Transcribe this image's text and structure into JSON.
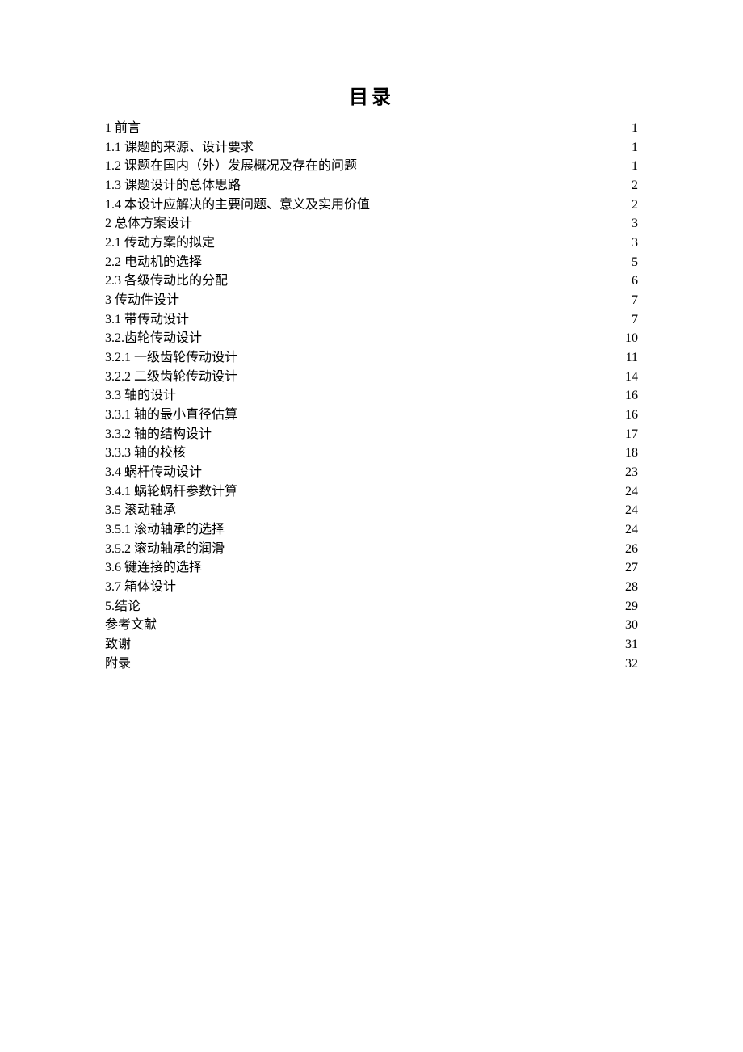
{
  "title": "目录",
  "toc": [
    {
      "label": "1 前言",
      "page": "1"
    },
    {
      "label": "1.1 课题的来源、设计要求",
      "page": "1"
    },
    {
      "label": "1.2 课题在国内（外）发展概况及存在的问题",
      "page": "1"
    },
    {
      "label": "1.3 课题设计的总体思路",
      "page": "2"
    },
    {
      "label": "1.4 本设计应解决的主要问题、意义及实用价值",
      "page": "2"
    },
    {
      "label": "2 总体方案设计",
      "page": "3"
    },
    {
      "label": "2.1 传动方案的拟定",
      "page": "3"
    },
    {
      "label": "2.2 电动机的选择",
      "page": "5"
    },
    {
      "label": "2.3 各级传动比的分配",
      "page": "6"
    },
    {
      "label": "3 传动件设计",
      "page": "7"
    },
    {
      "label": "3.1 带传动设计",
      "page": "7"
    },
    {
      "label": "3.2.齿轮传动设计",
      "page": "10"
    },
    {
      "label": "3.2.1 一级齿轮传动设计",
      "page": "11"
    },
    {
      "label": "3.2.2 二级齿轮传动设计",
      "page": "14"
    },
    {
      "label": "3.3 轴的设计",
      "page": "16"
    },
    {
      "label": "3.3.1 轴的最小直径估算",
      "page": "16"
    },
    {
      "label": "3.3.2 轴的结构设计",
      "page": "17"
    },
    {
      "label": "3.3.3 轴的校核",
      "page": "18"
    },
    {
      "label": "3.4 蜗杆传动设计",
      "page": "23"
    },
    {
      "label": "3.4.1 蜗轮蜗杆参数计算",
      "page": "24"
    },
    {
      "label": "3.5 滚动轴承",
      "page": "24"
    },
    {
      "label": "3.5.1 滚动轴承的选择",
      "page": "24"
    },
    {
      "label": "3.5.2 滚动轴承的润滑",
      "page": "26"
    },
    {
      "label": "3.6 键连接的选择",
      "page": "27"
    },
    {
      "label": "3.7 箱体设计",
      "page": "28"
    },
    {
      "label": "5.结论",
      "page": "29"
    },
    {
      "label": "参考文献",
      "page": "30"
    },
    {
      "label": "致谢",
      "page": "31"
    },
    {
      "label": "附录",
      "page": "32"
    }
  ]
}
